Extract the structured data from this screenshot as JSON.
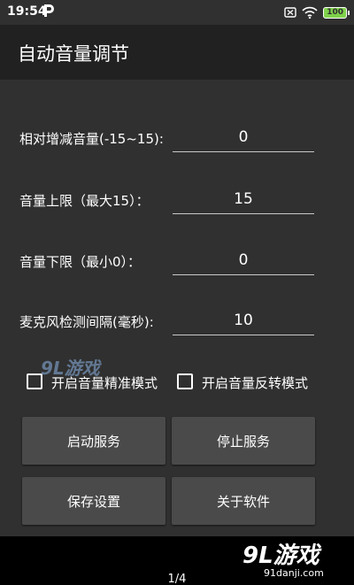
{
  "status_bar": {
    "time": "19:54",
    "battery": "100"
  },
  "app": {
    "title": "自动音量调节"
  },
  "fields": [
    {
      "label": "相对增减音量(-15~15):",
      "value": "0"
    },
    {
      "label": "音量上限（最大15）：",
      "value": "15"
    },
    {
      "label": "音量下限（最小0）：",
      "value": "0"
    },
    {
      "label": "麦克风检测间隔(毫秒):",
      "value": "10"
    }
  ],
  "checkboxes": [
    {
      "label": "开启音量精准模式",
      "checked": false
    },
    {
      "label": "开启音量反转模式",
      "checked": false
    }
  ],
  "buttons": {
    "start": "启动服务",
    "stop": "停止服务",
    "save": "保存设置",
    "about": "关于软件"
  },
  "pager": {
    "text": "1/4"
  },
  "watermark": {
    "center": "9L游戏",
    "logo": "9L游戏",
    "url": "91danji.com"
  },
  "colors": {
    "status_bar": "#303030",
    "app_bar": "#212121",
    "content": "#303030",
    "button": "#4a4a4a",
    "battery": "#7fd14b"
  }
}
